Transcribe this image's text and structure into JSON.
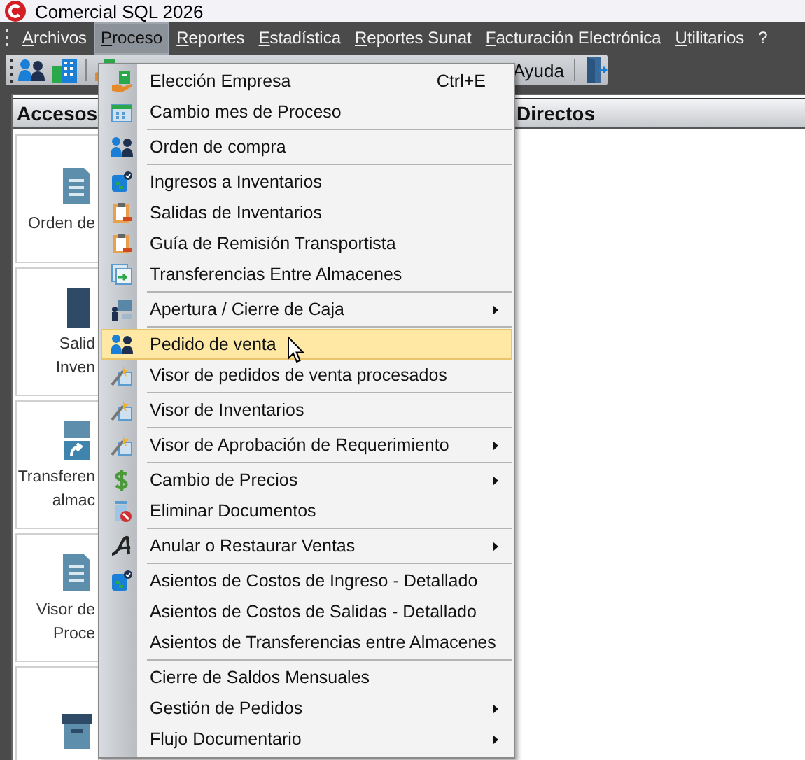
{
  "window": {
    "title": "Comercial SQL 2026"
  },
  "menubar": [
    {
      "label": "Archivos",
      "mnemonic": true,
      "selected": false
    },
    {
      "label": "Proceso",
      "mnemonic": true,
      "selected": true
    },
    {
      "label": "Reportes",
      "mnemonic": true,
      "selected": false
    },
    {
      "label": "Estadística",
      "mnemonic": true,
      "selected": false
    },
    {
      "label": "Reportes Sunat",
      "mnemonic": true,
      "selected": false
    },
    {
      "label": "Facturación Electrónica",
      "mnemonic": true,
      "selected": false
    },
    {
      "label": "Utilitarios",
      "mnemonic": true,
      "selected": false
    },
    {
      "label": "?",
      "mnemonic": false,
      "selected": false
    }
  ],
  "toolbar": {
    "help_label": "Ayuda"
  },
  "panel": {
    "title_left": "Accesos",
    "title_right": "Directos",
    "tiles": [
      {
        "kind": "shortcut",
        "lines": [
          "Orden de"
        ]
      },
      {
        "kind": "shortcut",
        "lines": [
          "Salid",
          "Inven"
        ]
      },
      {
        "kind": "shortcut",
        "lines": [
          "Transferen",
          "almac"
        ]
      },
      {
        "kind": "shortcut",
        "lines": [
          "Visor de",
          "Proce"
        ]
      },
      {
        "kind": "shortcut"
      }
    ]
  },
  "menu": {
    "items": [
      {
        "kind": "item",
        "label": "Elección Empresa",
        "shortcut": "Ctrl+E",
        "has_icon": true,
        "submenu": false,
        "selected": false
      },
      {
        "kind": "item",
        "label": "Cambio mes de Proceso",
        "has_icon": true,
        "submenu": false,
        "selected": false
      },
      {
        "kind": "separator"
      },
      {
        "kind": "item",
        "label": "Orden de compra",
        "has_icon": true,
        "submenu": false,
        "selected": false
      },
      {
        "kind": "separator"
      },
      {
        "kind": "item",
        "label": "Ingresos a Inventarios",
        "has_icon": true,
        "submenu": false,
        "selected": false
      },
      {
        "kind": "item",
        "label": "Salidas de Inventarios",
        "has_icon": true,
        "submenu": false,
        "selected": false
      },
      {
        "kind": "item",
        "label": "Guía de Remisión Transportista",
        "has_icon": true,
        "submenu": false,
        "selected": false
      },
      {
        "kind": "item",
        "label": "Transferencias Entre Almacenes",
        "has_icon": true,
        "submenu": false,
        "selected": false
      },
      {
        "kind": "separator"
      },
      {
        "kind": "item",
        "label": "Apertura / Cierre de Caja",
        "has_icon": true,
        "submenu": true,
        "selected": false
      },
      {
        "kind": "separator"
      },
      {
        "kind": "item",
        "label": "Pedido de venta",
        "has_icon": true,
        "submenu": false,
        "selected": true
      },
      {
        "kind": "item",
        "label": "Visor de pedidos de venta procesados",
        "has_icon": true,
        "submenu": false,
        "selected": false
      },
      {
        "kind": "separator"
      },
      {
        "kind": "item",
        "label": "Visor de Inventarios",
        "has_icon": true,
        "submenu": false,
        "selected": false
      },
      {
        "kind": "separator"
      },
      {
        "kind": "item",
        "label": "Visor de Aprobación de Requerimiento",
        "has_icon": true,
        "submenu": true,
        "selected": false
      },
      {
        "kind": "separator"
      },
      {
        "kind": "item",
        "label": "Cambio de Precios",
        "has_icon": true,
        "submenu": true,
        "selected": false
      },
      {
        "kind": "item",
        "label": "Eliminar Documentos",
        "has_icon": true,
        "submenu": false,
        "selected": false
      },
      {
        "kind": "separator"
      },
      {
        "kind": "item",
        "label": "Anular o Restaurar Ventas",
        "has_icon": true,
        "submenu": true,
        "selected": false
      },
      {
        "kind": "separator"
      },
      {
        "kind": "item",
        "label": "Asientos de Costos de Ingreso  - Detallado",
        "has_icon": true,
        "submenu": false,
        "selected": false
      },
      {
        "kind": "item",
        "label": "Asientos de Costos de Salidas - Detallado",
        "has_icon": false,
        "submenu": false,
        "selected": false
      },
      {
        "kind": "item",
        "label": "Asientos de Transferencias entre Almacenes",
        "has_icon": false,
        "submenu": false,
        "selected": false
      },
      {
        "kind": "separator"
      },
      {
        "kind": "item",
        "label": "Cierre de Saldos Mensuales",
        "has_icon": false,
        "submenu": false,
        "selected": false
      },
      {
        "kind": "item",
        "label": "Gestión de Pedidos",
        "has_icon": false,
        "submenu": true,
        "selected": false
      },
      {
        "kind": "item",
        "label": "Flujo Documentario",
        "has_icon": false,
        "submenu": true,
        "selected": false
      }
    ]
  }
}
